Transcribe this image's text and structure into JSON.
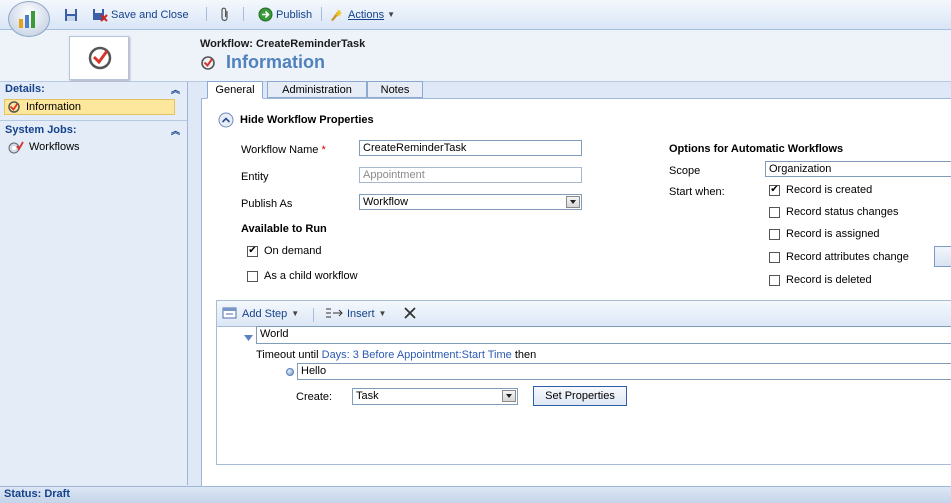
{
  "toolbar": {
    "save_close": "Save and Close",
    "publish": "Publish",
    "actions": "Actions"
  },
  "header": {
    "workflow_title": "Workflow: CreateReminderTask",
    "section_title": "Information"
  },
  "sidebar": {
    "details_label": "Details:",
    "details_item": "Information",
    "system_jobs_label": "System Jobs:",
    "system_jobs_item": "Workflows"
  },
  "tabs": [
    "General",
    "Administration",
    "Notes"
  ],
  "general": {
    "hide_props": "Hide Workflow Properties",
    "workflow_name_label": "Workflow Name",
    "workflow_name_value": "CreateReminderTask",
    "entity_label": "Entity",
    "entity_placeholder": "Appointment",
    "publish_as_label": "Publish As",
    "publish_as_value": "Workflow",
    "available_label": "Available to Run",
    "on_demand": "On demand",
    "child_workflow": "As a child workflow"
  },
  "auto_options": {
    "title": "Options for Automatic Workflows",
    "scope_label": "Scope",
    "scope_value": "Organization",
    "start_when_label": "Start when:",
    "opt_created": "Record is created",
    "opt_status": "Record status changes",
    "opt_assigned": "Record is assigned",
    "opt_attributes": "Record attributes change",
    "opt_deleted": "Record is deleted"
  },
  "steps": {
    "add_step": "Add Step",
    "insert": "Insert",
    "stage_name": "World",
    "timeout_prefix": "Timeout until",
    "timeout_link": "Days: 3 Before Appointment:Start Time",
    "timeout_suffix": "then",
    "step_name": "Hello",
    "create_label": "Create:",
    "create_value": "Task",
    "set_properties": "Set Properties"
  },
  "status": {
    "text": "Status: Draft"
  }
}
